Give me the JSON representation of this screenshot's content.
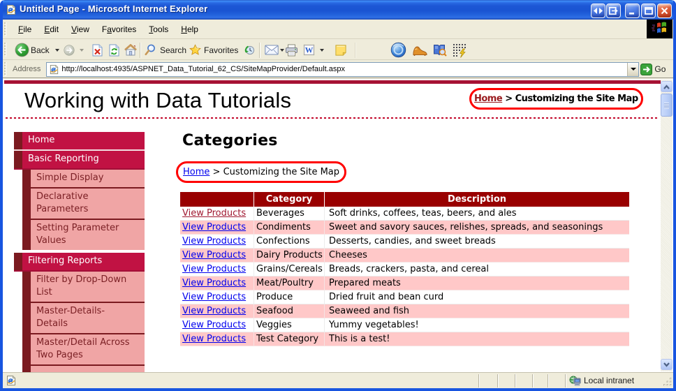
{
  "window": {
    "title": "Untitled Page - Microsoft Internet Explorer"
  },
  "menu_bar": {
    "items": [
      {
        "label": "File",
        "accel": 0
      },
      {
        "label": "Edit",
        "accel": 0
      },
      {
        "label": "View",
        "accel": 0
      },
      {
        "label": "Favorites",
        "accel": 1
      },
      {
        "label": "Tools",
        "accel": 0
      },
      {
        "label": "Help",
        "accel": 0
      }
    ]
  },
  "toolbar": {
    "back_label": "Back",
    "search_label": "Search",
    "favorites_label": "Favorites"
  },
  "address_bar": {
    "label": "Address",
    "url": "http://localhost:4935/ASPNET_Data_Tutorial_62_CS/SiteMapProvider/Default.aspx",
    "go_label": "Go"
  },
  "page": {
    "header_title": "Working with Data Tutorials",
    "breadcrumb_top": {
      "home": "Home",
      "sep": " > ",
      "current": "Customizing the Site Map"
    },
    "heading": "Categories",
    "breadcrumb": {
      "home": "Home",
      "sep": " > ",
      "current": "Customizing the Site Map"
    },
    "sidebar_menu": [
      {
        "label": "Home",
        "level": 1
      },
      {
        "label": "Basic Reporting",
        "level": 1
      },
      {
        "label": "Simple Display",
        "level": 2
      },
      {
        "label": "Declarative\nParameters",
        "level": 2
      },
      {
        "label": "Setting Parameter\nValues",
        "level": 2
      },
      {
        "label": "Filtering Reports",
        "level": 1
      },
      {
        "label": "Filter by Drop-Down\nList",
        "level": 2
      },
      {
        "label": "Master-Details-\nDetails",
        "level": 2
      },
      {
        "label": "Master/Detail Across\nTwo Pages",
        "level": 2
      }
    ],
    "table": {
      "headers": [
        "",
        "Category",
        "Description"
      ],
      "link_label": "View Products",
      "rows": [
        {
          "category": "Beverages",
          "description": "Soft drinks, coffees, teas, beers, and ales",
          "visited": true
        },
        {
          "category": "Condiments",
          "description": "Sweet and savory sauces, relishes, spreads, and seasonings",
          "visited": false
        },
        {
          "category": "Confections",
          "description": "Desserts, candies, and sweet breads",
          "visited": false
        },
        {
          "category": "Dairy Products",
          "description": "Cheeses",
          "visited": false
        },
        {
          "category": "Grains/Cereals",
          "description": "Breads, crackers, pasta, and cereal",
          "visited": false
        },
        {
          "category": "Meat/Poultry",
          "description": "Prepared meats",
          "visited": false
        },
        {
          "category": "Produce",
          "description": "Dried fruit and bean curd",
          "visited": false
        },
        {
          "category": "Seafood",
          "description": "Seaweed and fish",
          "visited": false
        },
        {
          "category": "Veggies",
          "description": "Yummy vegetables!",
          "visited": false
        },
        {
          "category": "Test Category",
          "description": "This is a test!",
          "visited": false
        }
      ]
    }
  },
  "status_bar": {
    "zone": "Local intranet"
  },
  "colors": {
    "crimson_menu": "#C11243",
    "dark_maroon": "#7B1A20",
    "menu_pink": "#F0A5A5",
    "table_header_maroon": "#990000",
    "table_row_pink": "#FFC8C8",
    "link_blue": "#0000EE",
    "link_visited": "#A01931",
    "annotation_red": "#FF0000",
    "titlebar_blue": "#1A54D2",
    "page_top_bar": "#A61234"
  }
}
